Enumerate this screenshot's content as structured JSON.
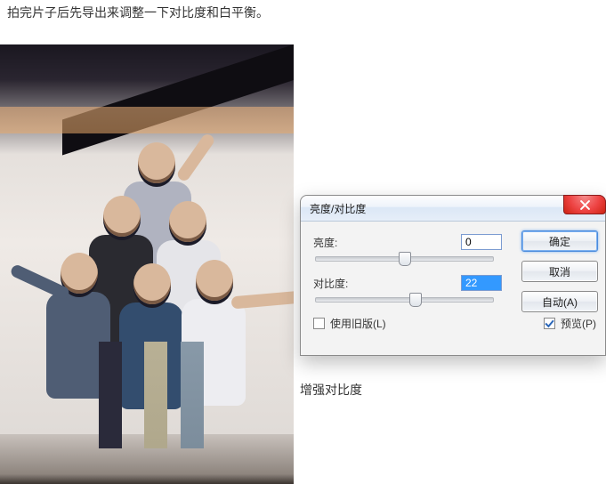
{
  "intro_text": "拍完片子后先导出来调整一下对比度和白平衡。",
  "dialog": {
    "title": "亮度/对比度",
    "brightness": {
      "label": "亮度:",
      "value": "0"
    },
    "contrast": {
      "label": "对比度:",
      "value": "22"
    },
    "legacy": {
      "label": "使用旧版(L)",
      "checked": false
    },
    "preview": {
      "label": "预览(P)",
      "checked": true
    },
    "buttons": {
      "ok": "确定",
      "cancel": "取消",
      "auto": "自动(A)"
    }
  },
  "caption_below": "增强对比度"
}
